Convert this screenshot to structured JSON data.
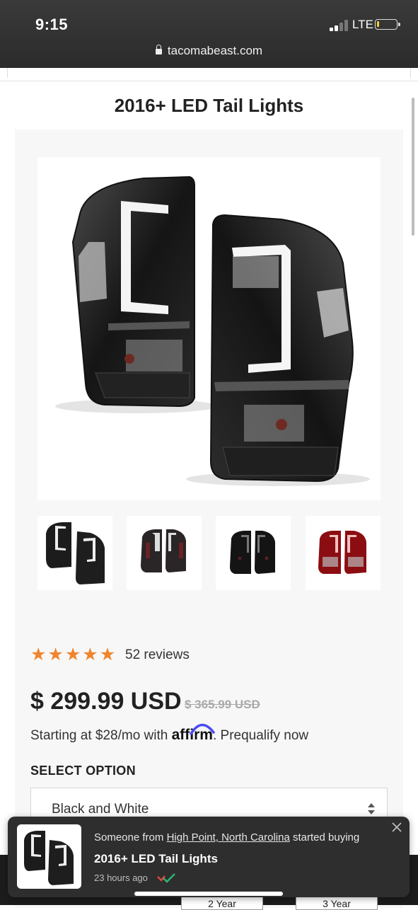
{
  "status_bar": {
    "time": "9:15",
    "network": "LTE"
  },
  "browser": {
    "url": "tacomabeast.com"
  },
  "product": {
    "title": "2016+ LED Tail Lights",
    "rating": {
      "stars": 5,
      "reviews_text": "52 reviews"
    },
    "price": "$ 299.99 USD",
    "compare_price": "$ 365.99 USD",
    "financing": {
      "prefix": "Starting at $28/mo with",
      "brand": "affirm",
      "suffix": ". Prequalify now"
    },
    "option_label": "SELECT OPTION",
    "selected_option": "Black and White",
    "thumbnails": [
      "black-white",
      "smoked-red",
      "all-black",
      "red"
    ]
  },
  "warranty_tabs": [
    "2 Year",
    "3 Year"
  ],
  "notification": {
    "prefix": "Someone from",
    "location": "High Point, North Carolina",
    "suffix": "started buying",
    "product": "2016+ LED Tail Lights",
    "time": "23 hours ago"
  },
  "colors": {
    "star": "#f0852d",
    "notification_bg": "#2e2e2e",
    "page_bg": "#f7f7f7"
  }
}
